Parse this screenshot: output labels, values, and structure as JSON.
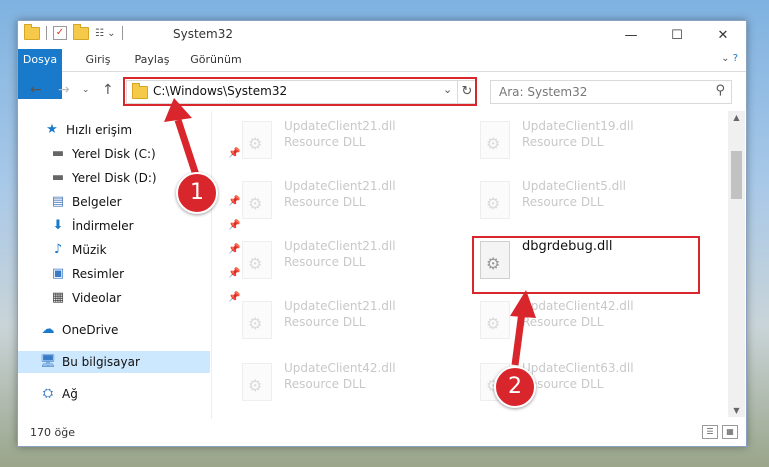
{
  "window": {
    "title": "System32",
    "caption": {
      "minimize": "—",
      "maximize": "☐",
      "close": "✕"
    }
  },
  "ribbon": {
    "tabs": [
      "Dosya",
      "Giriş",
      "Paylaş",
      "Görünüm"
    ],
    "expand": "⌄",
    "help": "?"
  },
  "nav": {
    "address": "C:\\Windows\\System32",
    "search_placeholder": "Ara: System32"
  },
  "sidebar": {
    "quick_access": "Hızlı erişim",
    "items": [
      {
        "label": "Yerel Disk (C:)",
        "icon": "drive-icon"
      },
      {
        "label": "Yerel Disk (D:)",
        "icon": "drive-icon"
      },
      {
        "label": "Belgeler",
        "icon": "documents-icon"
      },
      {
        "label": "İndirmeler",
        "icon": "downloads-icon"
      },
      {
        "label": "Müzik",
        "icon": "music-icon"
      },
      {
        "label": "Resimler",
        "icon": "pictures-icon"
      },
      {
        "label": "Videolar",
        "icon": "videos-icon"
      }
    ],
    "onedrive": "OneDrive",
    "this_pc": "Bu bilgisayar",
    "network": "Ağ"
  },
  "files": [
    {
      "name": "UpdateClient21.dll",
      "type": "Resource DLL"
    },
    {
      "name": "UpdateClient19.dll",
      "type": "Resource DLL"
    },
    {
      "name": "UpdateClient21.dll",
      "type": "Resource DLL"
    },
    {
      "name": "UpdateClient5.dll",
      "type": "Resource DLL"
    },
    {
      "name": "UpdateClient21.dll",
      "type": "Resource DLL"
    },
    {
      "name": "dbgrdebug.dll",
      "type": ""
    },
    {
      "name": "UpdateClient21.dll",
      "type": "Resource DLL"
    },
    {
      "name": "UpdateClient42.dll",
      "type": "Resource DLL"
    },
    {
      "name": "UpdateClient42.dll",
      "type": "Resource DLL"
    },
    {
      "name": "UpdateClient63.dll",
      "type": "Resource DLL"
    }
  ],
  "status": {
    "item_count": "170 öğe"
  },
  "callouts": [
    "1",
    "2"
  ],
  "colors": {
    "accent": "#1979ca",
    "highlight": "#d9262c",
    "selected_nav": "#cce8ff"
  }
}
